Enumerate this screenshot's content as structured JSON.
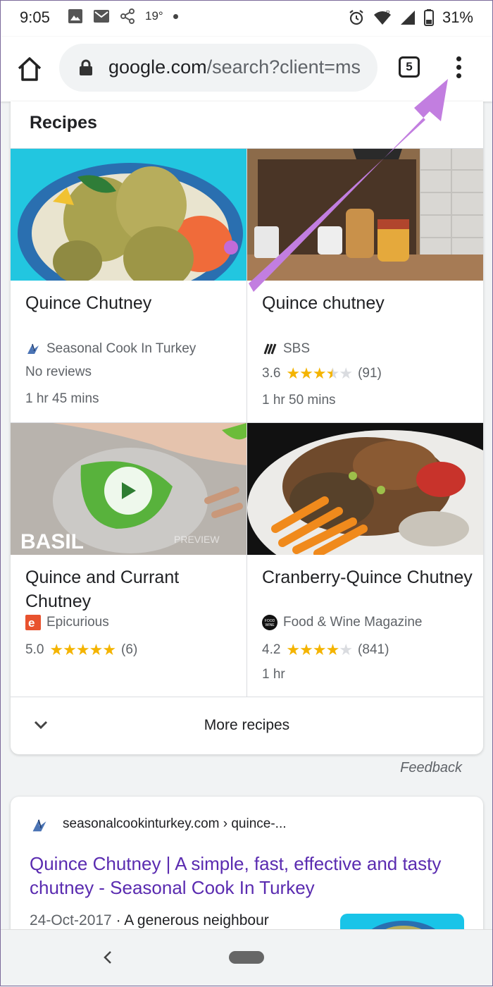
{
  "status_bar": {
    "time": "9:05",
    "temperature": "19°",
    "battery": "31%",
    "network_badge": "R"
  },
  "browser": {
    "url_host": "google.com",
    "url_path": "/search?client=ms",
    "tab_count": "5"
  },
  "recipes": {
    "heading": "Recipes",
    "items": [
      {
        "title": "Quince Chutney",
        "source": "Seasonal Cook In Turkey",
        "reviews_text": "No reviews",
        "time": "1 hr 45 mins"
      },
      {
        "title": "Quince chutney",
        "source": "SBS",
        "rating": "3.6",
        "rating_value": 3.6,
        "review_count": "(91)",
        "time": "1 hr 50 mins"
      },
      {
        "title": "Quince and Currant Chutney",
        "source": "Epicurious",
        "rating": "5.0",
        "rating_value": 5.0,
        "review_count": "(6)",
        "thumb_overlay_text": "BASIL",
        "thumb_watermark": "PREVIEW"
      },
      {
        "title": "Cranberry-Quince Chutney",
        "source": "Food & Wine Magazine",
        "rating": "4.2",
        "rating_value": 4.2,
        "review_count": "(841)",
        "time": "1 hr",
        "source_icon_text": "FOOD WINE"
      }
    ],
    "more_label": "More recipes"
  },
  "feedback_label": "Feedback",
  "result": {
    "breadcrumb": "seasonalcookinturkey.com › quince-...",
    "title": "Quince Chutney | A simple, fast, effective and tasty chutney - Seasonal Cook In Turkey",
    "date": "24-Oct-2017",
    "snippet": " · A generous neighbour"
  },
  "colors": {
    "link": "#5a2bb0",
    "star": "#f4b400",
    "arrow": "#c27ee0"
  }
}
